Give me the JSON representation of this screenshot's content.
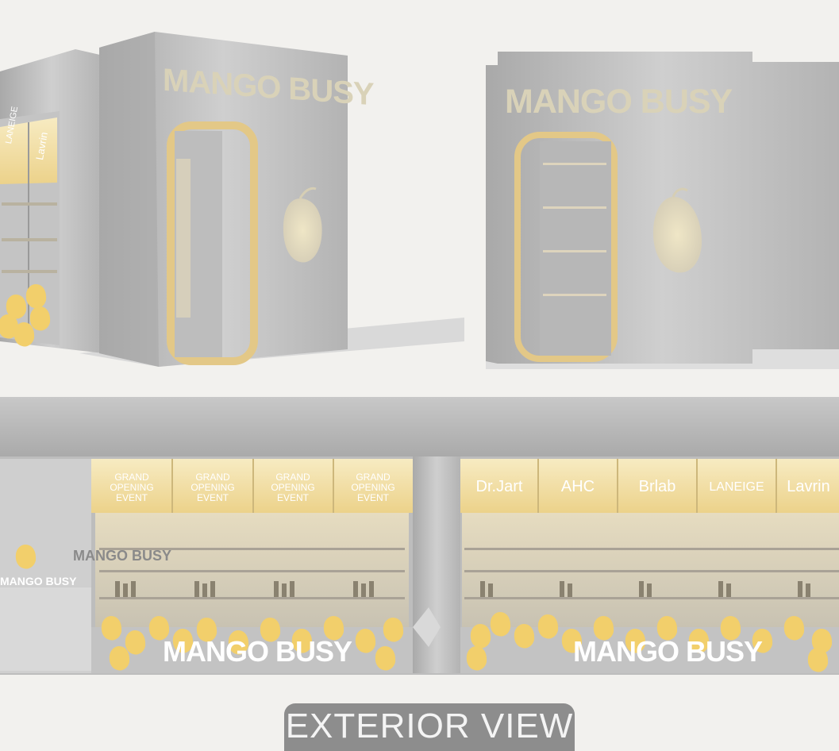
{
  "brand_name": "MANGO BUSY",
  "event_banner": [
    "GRAND",
    "OPENING",
    "EVENT"
  ],
  "brand_banners": [
    "Dr.Jart",
    "AHC",
    "Brlab",
    "LANEIGE",
    "Lavrin"
  ],
  "side_panel_labels": [
    "LANEIGE",
    "Lavrin"
  ],
  "caption": "EXTERIOR VIEW",
  "colors": {
    "metal": "#b4b4b4",
    "mango": "#f2cf6b",
    "banner": "#f6e7b4",
    "background": "#f2f1ee",
    "caption_tab": "#8d8d8d"
  },
  "icons": [
    "mango-icon"
  ]
}
